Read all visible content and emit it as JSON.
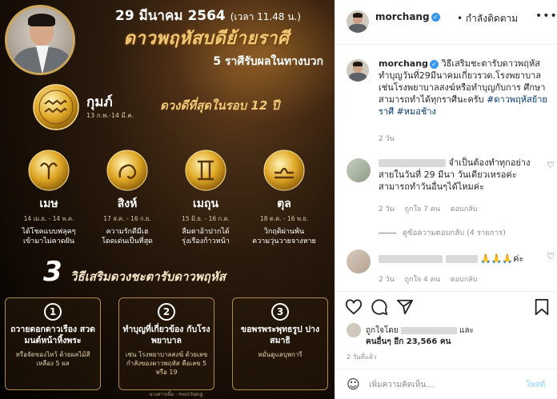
{
  "post_image": {
    "date": "29 มีนาคม 2564",
    "time": "(เวลา 11.48 น.)",
    "title": "ดาวพฤหัสบดีย้ายราศี",
    "subtitle": "5 ราศีรับผลในทางบวก",
    "main_sign": {
      "name": "กุมภ์",
      "dates": "13 ก.พ.-14 มี.ค.",
      "headline": "ดวงดีที่สุดในรอบ 12 ปี"
    },
    "signs": [
      {
        "name": "เมษ",
        "dates": "14 เม.ย. - 14 พ.ค.",
        "desc1": "ได้โชคแบบฟลุคๆ",
        "desc2": "เข้ามาไม่คาดฝัน"
      },
      {
        "name": "สิงห์",
        "dates": "17 ส.ค. - 16 ก.ย.",
        "desc1": "ความรักดีมีเฮ",
        "desc2": "โดดเด่นเป็นที่สุด"
      },
      {
        "name": "เมถุน",
        "dates": "15 มิ.ย. - 16 ก.ค.",
        "desc1": "ลืมตาอ้าปากได้",
        "desc2": "รุ่งเรืองก้าวหน้า"
      },
      {
        "name": "ตุล",
        "dates": "18 ต.ค. - 16 พ.ย.",
        "desc1": "วิกฤติผ่านพ้น",
        "desc2": "ความวุ่นวายจางหาย"
      }
    ],
    "methods_number": "3",
    "methods_title": "วิธีเสริมดวงชะตารับดาวพฤหัส",
    "methods": [
      {
        "num": "1",
        "head": "ถวายดอกดาวเรือง สวดมนต์หน้าหิ้งพระ",
        "detail": "หรือจัดของไหว้ ด้วยผลไม้สีเหลือง 5 ผล"
      },
      {
        "num": "2",
        "head": "ทำบุญที่เกี่ยวข้อง กับโรงพยาบาล",
        "detail": "เช่น โรงพยาบาลสงฆ์ ด้วยเลขกำลังของดาวพฤหัส คือเลข 5 หรือ 19"
      },
      {
        "num": "3",
        "head": "ขอพรพระพุทธรูป ปางสมาธิ",
        "detail": "หมั่นดูแลบุพการี"
      }
    ],
    "footer": "นางสาวเบิ้ม - morchang"
  },
  "header": {
    "username": "morchang",
    "follow_label": "• กำลังติดตาม",
    "more_icon": "more-horizontal-icon"
  },
  "caption": {
    "username": "morchang",
    "text": "วิธีเสริมชะตารับดาวพฤหัส ทำบุญวันที่29มีนาคมเกี่ยวรวด.โรงพยาบาล เช่นโรงพยาบาลสงฆ์หรือทำบุญกับการ ศึกษา สามารถทำได้ทุกราศีนะครับ",
    "hashtag1": "#ดาวพฤหัสย้ายราศี",
    "hashtag2": "#หมอช้าง",
    "time": "2 วัน"
  },
  "comments": [
    {
      "text": "จำเป็นต้องทำทุกอย่างสายในวันที่ 29 มีนา วันเดียวเหรอค่ะ สามารถทำวันอื่นๆได้ไหมค่ะ",
      "time": "2 วัน",
      "likes": "ถูกใจ 7 คน",
      "reply": "ตอบกลับ",
      "view_replies": "ดูข้อความตอบกลับ (4 รายการ)"
    },
    {
      "text": "🙏🙏🙏ค่ะ",
      "time": "2 วัน",
      "likes": "ถูกใจ 4 คน",
      "reply": "ตอบกลับ"
    }
  ],
  "likes": {
    "line1_prefix": "ถูกใจโดย",
    "line1_suffix": "และ",
    "line2": "คนอื่นๆ อีก 23,566 คน"
  },
  "post_time": "2 วันที่แล้ว",
  "add_comment": {
    "placeholder": "เพิ่มความคิดเห็น...",
    "post_label": "โพสต์"
  }
}
